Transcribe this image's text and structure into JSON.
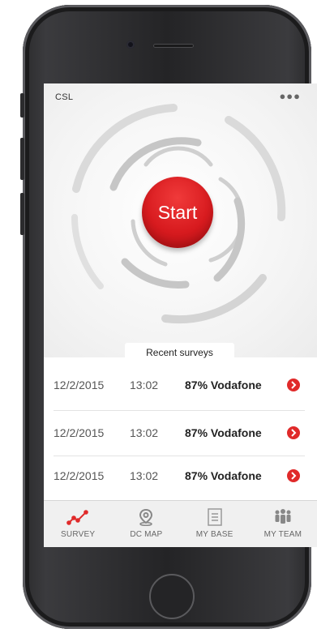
{
  "header": {
    "title": "CSL",
    "more_icon": "more-dots-icon"
  },
  "start_button": {
    "label": "Start",
    "color": "#d81b1f"
  },
  "recent": {
    "title": "Recent surveys",
    "rows": [
      {
        "date": "12/2/2015",
        "time": "13:02",
        "result": "87% Vodafone"
      },
      {
        "date": "12/2/2015",
        "time": "13:02",
        "result": "87% Vodafone"
      },
      {
        "date": "12/2/2015",
        "time": "13:02",
        "result": "87% Vodafone"
      }
    ]
  },
  "tabs": [
    {
      "label": "SURVEY",
      "icon": "survey-graph-icon",
      "active": true
    },
    {
      "label": "DC MAP",
      "icon": "map-pin-icon",
      "active": false
    },
    {
      "label": "MY BASE",
      "icon": "list-document-icon",
      "active": false
    },
    {
      "label": "MY TEAM",
      "icon": "team-people-icon",
      "active": false
    }
  ],
  "colors": {
    "accent": "#e02a2a",
    "tab_inactive": "#888888",
    "tab_label": "#666666"
  }
}
